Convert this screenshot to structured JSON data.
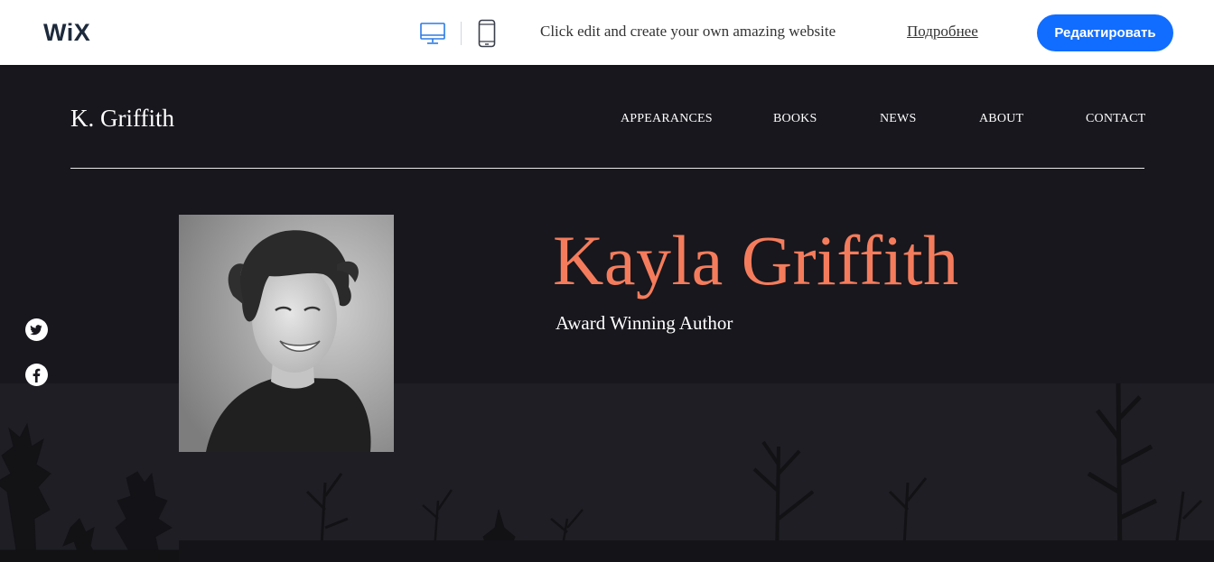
{
  "wix_bar": {
    "logo": "WiX",
    "promo_text": "Click edit and create your own amazing website",
    "learn_more": "Подробнее",
    "edit_button": "Редактировать",
    "devices": [
      "desktop-icon",
      "mobile-icon"
    ]
  },
  "site": {
    "logo": "K. Griffith",
    "nav": [
      "APPEARANCES",
      "BOOKS",
      "NEWS",
      "ABOUT",
      "CONTACT"
    ],
    "hero": {
      "name": "Kayla Griffith",
      "subtitle": "Award Winning Author"
    },
    "social": [
      "twitter-icon",
      "facebook-icon"
    ]
  },
  "colors": {
    "accent": "#f47c5c",
    "wix_blue": "#116dff",
    "background": "#17171d"
  }
}
